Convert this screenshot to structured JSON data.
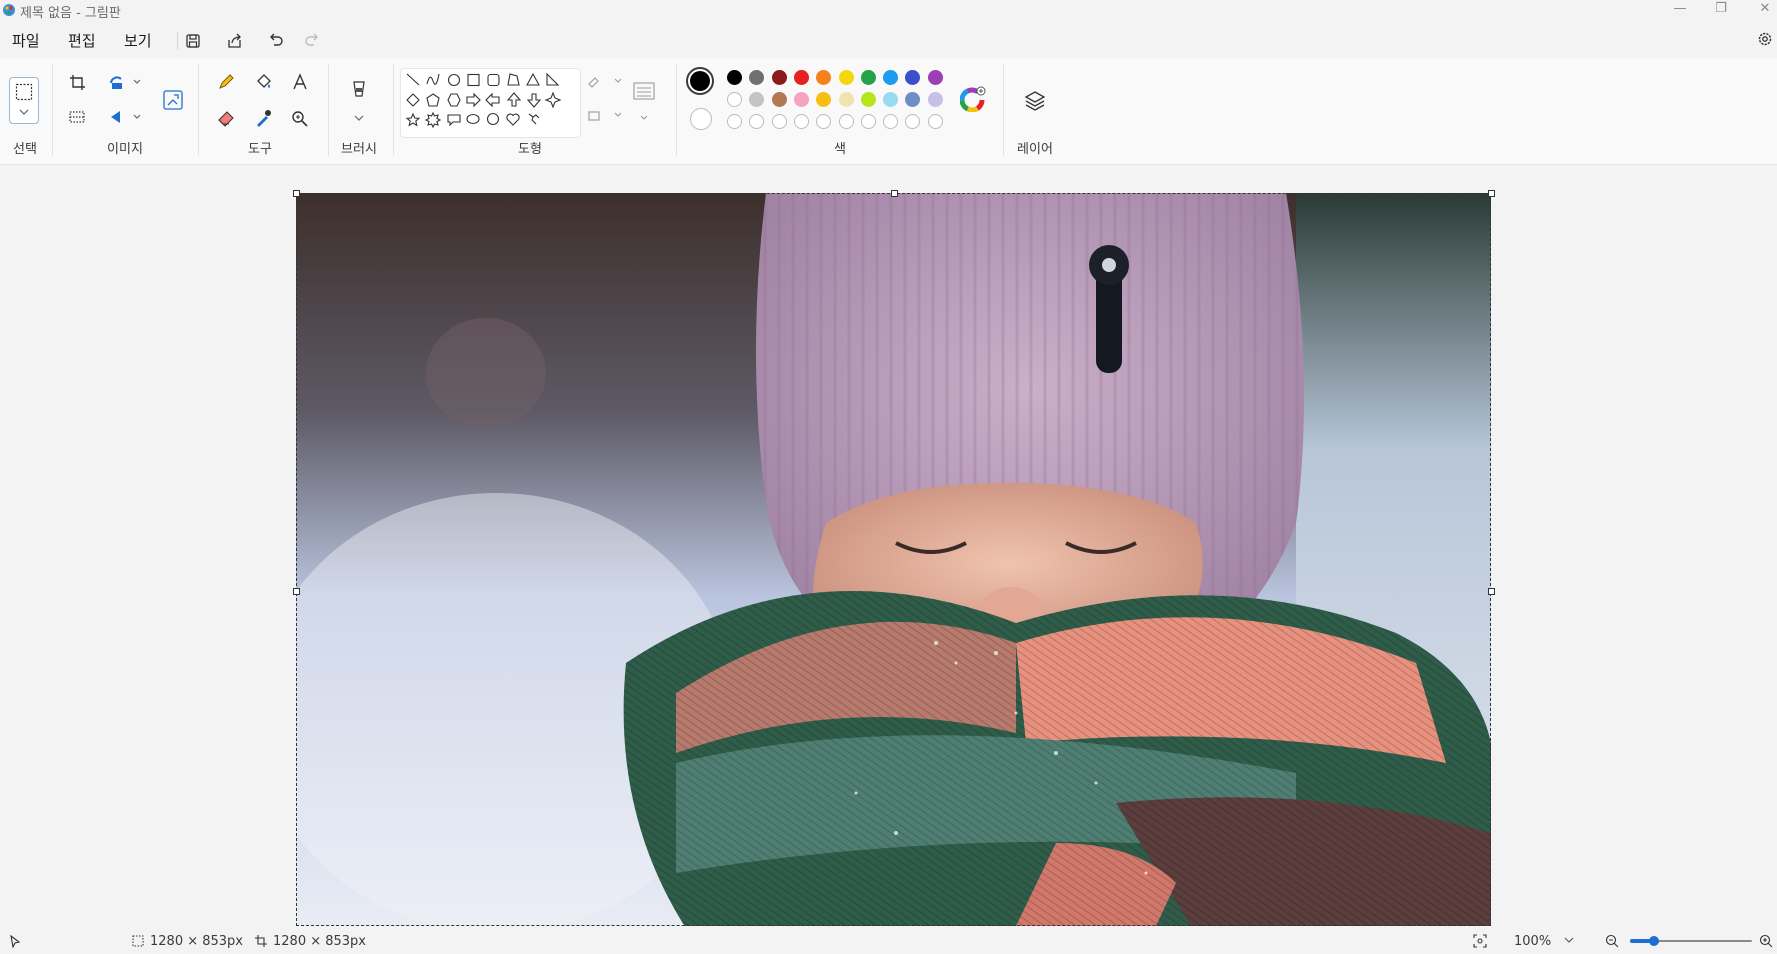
{
  "window": {
    "title": "제목 없음 - 그림판",
    "minimize_glyph": "—",
    "restore_glyph": "❐",
    "close_glyph": "✕"
  },
  "menu": {
    "file": "파일",
    "edit": "편집",
    "view": "보기"
  },
  "ribbon": {
    "groups": {
      "selection": "선택",
      "image": "이미지",
      "tools": "도구",
      "brushes": "브러시",
      "shapes": "도형",
      "colors": "색",
      "layers": "레이어"
    },
    "palette_row1": [
      "#000000",
      "#707070",
      "#8b1a1a",
      "#e8211e",
      "#f7801a",
      "#f5d70c",
      "#22a34b",
      "#1e9af1",
      "#3a50c9",
      "#9b3fb6"
    ],
    "palette_row2": [
      "#ffffff",
      "#c4c4c4",
      "#b47754",
      "#f4a3c1",
      "#f5c012",
      "#efe4b0",
      "#b5e61d",
      "#98daf0",
      "#6e8ec5",
      "#c8bfe7"
    ],
    "primary_color": "#000000",
    "secondary_color": "#ffffff"
  },
  "status": {
    "selection_size": "1280 × 853px",
    "canvas_size": "1280 × 853px",
    "zoom": "100%",
    "zoom_fraction": 0.2
  }
}
